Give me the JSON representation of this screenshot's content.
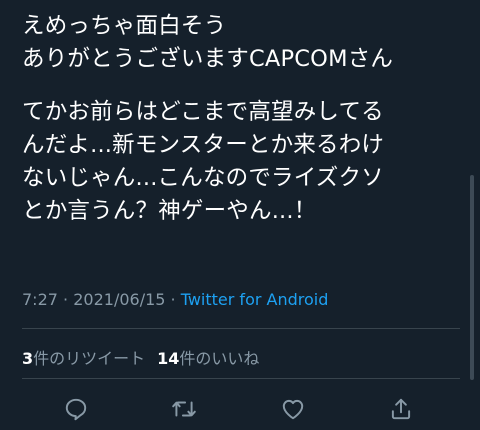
{
  "tweet": {
    "paragraphs": [
      [
        "えめっちゃ面白そう",
        "ありがとうございますCAPCOMさん"
      ],
      [
        "てかお前らはどこまで高望みしてる",
        "んだよ...新モンスターとか来るわけ",
        "ないじゃん...こんなのでライズクソ",
        "とか言うん？神ゲーやん...！"
      ]
    ],
    "time": "7:27",
    "separator": "·",
    "date": "2021/06/15",
    "source": "Twitter for Android"
  },
  "stats": {
    "retweets_count": "3",
    "retweets_label": "件のリツイート",
    "likes_count": "14",
    "likes_label": "件のいいね"
  },
  "actions": [
    {
      "name": "reply-icon"
    },
    {
      "name": "retweet-icon"
    },
    {
      "name": "like-icon"
    },
    {
      "name": "share-icon"
    }
  ],
  "colors": {
    "background": "#15202b",
    "text": "#ffffff",
    "secondary": "#8899a6",
    "link": "#1da1f2",
    "divider": "#38444d"
  }
}
